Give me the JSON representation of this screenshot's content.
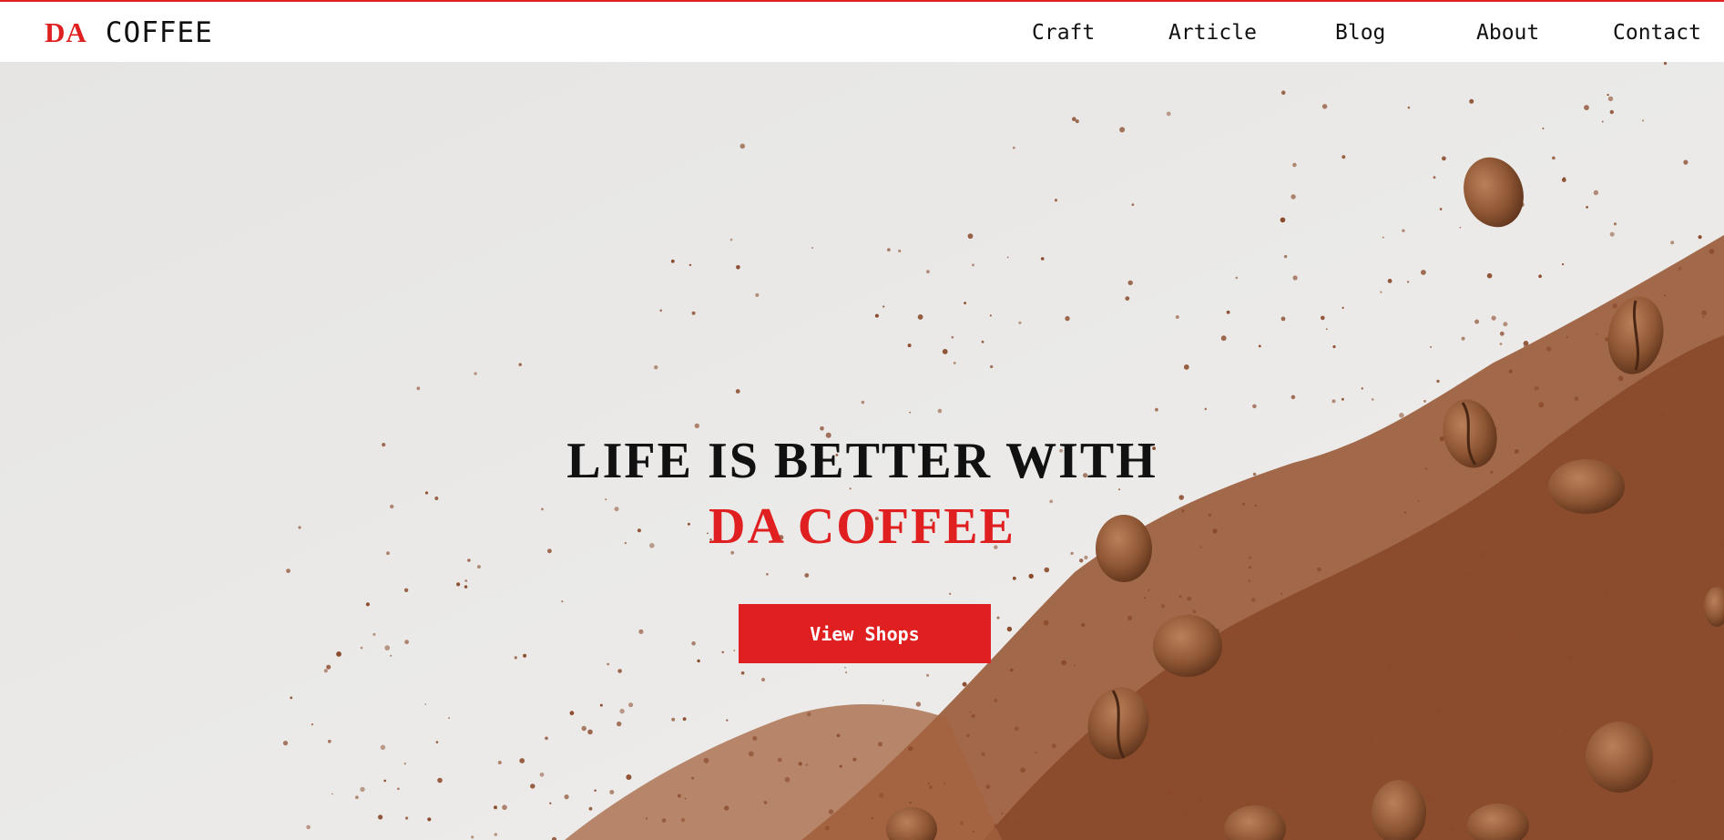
{
  "brand": {
    "accent": "#e02020",
    "text": "#111111",
    "logo_da": "DA",
    "logo_rest": "COFFEE"
  },
  "nav": {
    "items": [
      "Craft",
      "Article",
      "Blog",
      "About",
      "Contact"
    ]
  },
  "hero": {
    "headline_line1": "LIFE IS BETTER WITH",
    "headline_line2": "DA COFFEE",
    "cta_label": "View Shops",
    "background_image": "coffee-grounds-and-beans-photo"
  }
}
